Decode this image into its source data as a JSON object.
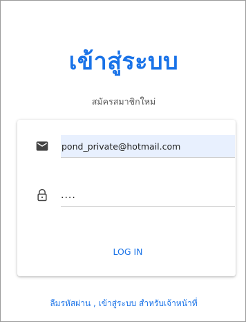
{
  "header": {
    "title": "เข้าสู่ระบบ",
    "register_link": "สมัครสมาชิกใหม่"
  },
  "form": {
    "email": {
      "value": "pond_private@hotmail.com",
      "icon": "email-icon"
    },
    "password": {
      "value": "....",
      "icon": "lock-icon"
    },
    "login_button": "LOG IN"
  },
  "footer": {
    "links_text": "ลืมรหัสผ่าน , เข้าสู่ระบบ สำหรับเจ้าหน้าที่"
  },
  "colors": {
    "accent": "#1a73e8",
    "autofill_background": "#e8f0fe",
    "muted_text": "#555555"
  }
}
